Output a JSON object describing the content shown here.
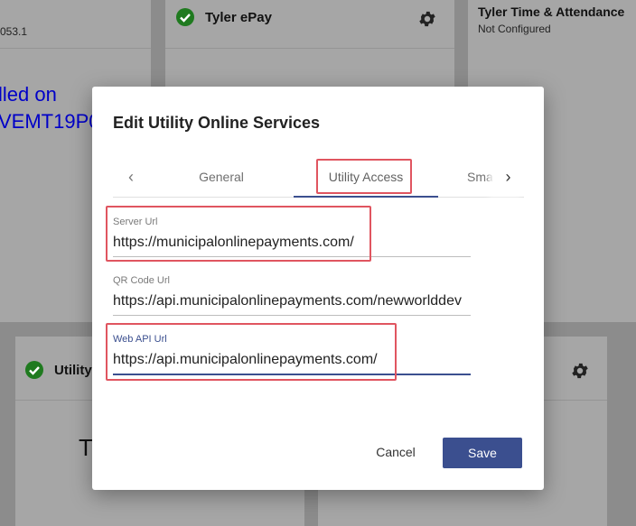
{
  "background": {
    "cards": [
      {
        "id": "card-left-top",
        "version": "053.1",
        "big_text_line1": "lled on",
        "big_text_line2": "VEMT19P0"
      },
      {
        "id": "card-tyler-epay",
        "title": "Tyler ePay"
      },
      {
        "id": "card-tyler-time",
        "title": "Tyler Time & Attendance",
        "subtitle": "Not Configured"
      },
      {
        "id": "card-utility",
        "title": "Utility",
        "big_text": "T"
      }
    ]
  },
  "modal": {
    "title": "Edit Utility Online Services",
    "tabs": {
      "prev_icon": "‹",
      "next_icon": "›",
      "items": [
        {
          "label": "General",
          "active": false
        },
        {
          "label": "Utility Access",
          "active": true
        },
        {
          "label": "Sma",
          "active": false
        }
      ]
    },
    "fields": [
      {
        "label": "Server Url",
        "value": "https://municipalonlinepayments.com/"
      },
      {
        "label": "QR Code Url",
        "value": "https://api.municipalonlinepayments.com/newworlddev"
      },
      {
        "label": "Web API Url",
        "value": "https://api.municipalonlinepayments.com/",
        "focused": true
      }
    ],
    "buttons": {
      "cancel": "Cancel",
      "save": "Save"
    }
  },
  "colors": {
    "primary": "#3b4f8f",
    "highlight": "#e05560",
    "success": "#1f7a1f",
    "link_text": "#0000c8"
  },
  "icons": [
    "check-circle-icon",
    "gear-icon",
    "chevron-left-icon",
    "chevron-right-icon"
  ]
}
